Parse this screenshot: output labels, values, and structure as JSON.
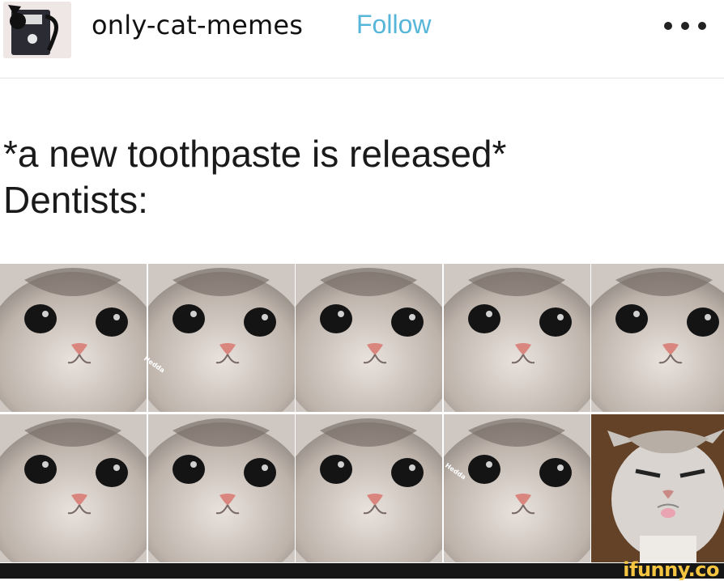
{
  "post": {
    "blog_name": "only-cat-memes",
    "follow_label": "Follow",
    "more_icon": "ellipsis-icon"
  },
  "caption": {
    "line1": "*a new toothpaste is released*",
    "line2": "Dentists:"
  },
  "image": {
    "watermark_text": "Hedda",
    "site_watermark": "ifunny.co"
  }
}
